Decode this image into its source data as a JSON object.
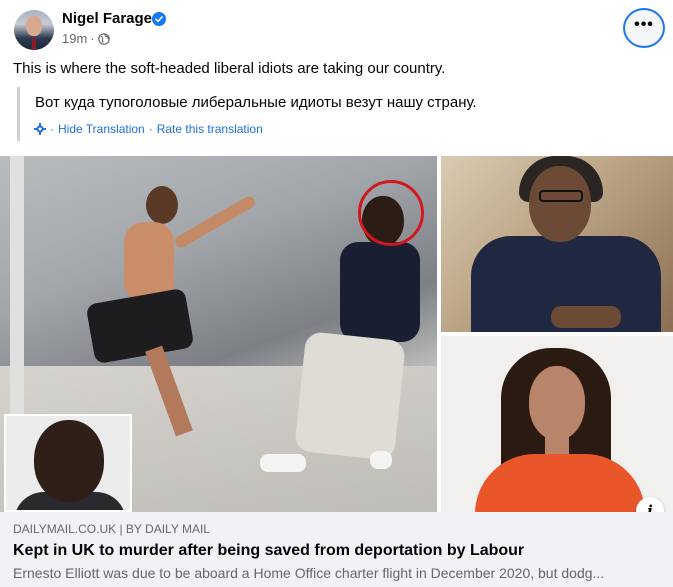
{
  "post": {
    "author": "Nigel Farage",
    "timestamp": "19m",
    "separator": "·",
    "audience_icon": "globe-icon",
    "verified_icon": "verified-badge-icon",
    "more_icon": "more-options-icon",
    "more_label": "•••",
    "text": "This is where the soft-headed liberal idiots are taking our country."
  },
  "translation": {
    "text": "Вот куда тупоголовые либеральные идиоты везут нашу страну.",
    "settings_icon": "gear-icon",
    "hide_label": "Hide Translation",
    "separator": "·",
    "rate_label": "Rate this translation"
  },
  "media": {
    "info_label": "i"
  },
  "link_preview": {
    "source": "DAILYMAIL.CO.UK | BY DAILY MAIL",
    "title": "Kept in UK to murder after being saved from deportation by Labour",
    "description": "Ernesto Elliott was due to be aboard a Home Office charter flight in December 2020, but dodg..."
  },
  "colors": {
    "link_blue": "#216fdb",
    "verified_blue": "#1877f2",
    "secondary_text": "#65676b",
    "preview_bg": "#f0f2f5",
    "highlight_red": "#d0181e"
  }
}
